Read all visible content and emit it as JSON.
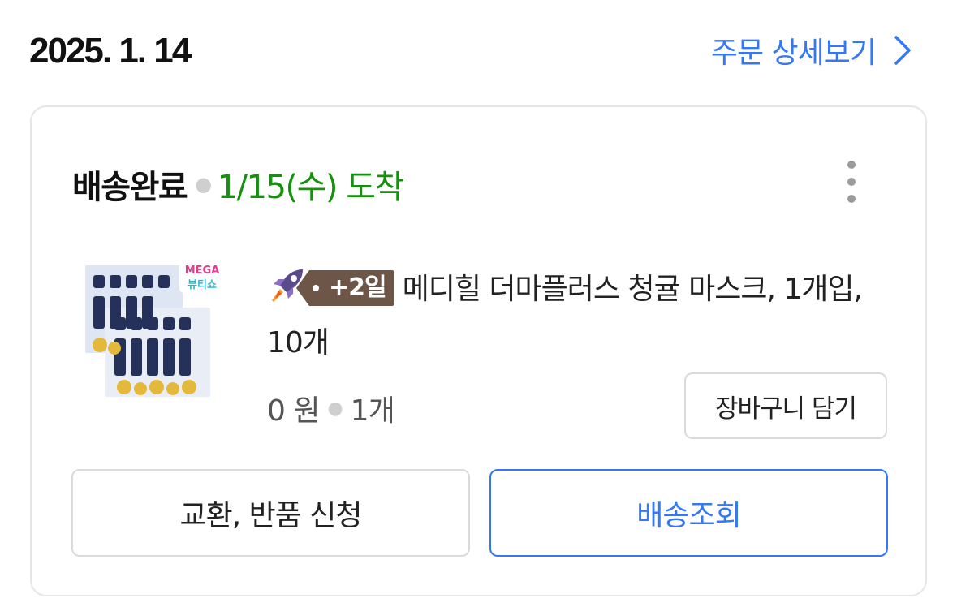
{
  "order": {
    "date": "2025. 1. 14",
    "detail_link": "주문 상세보기"
  },
  "card": {
    "status": "배송완료",
    "arrival": "1/15(수) 도착",
    "product": {
      "badge": "+2일",
      "name": "메디힐 더마플러스 청귤 마스크, 1개입, 10개",
      "price": "0 원",
      "quantity": "1개",
      "thumbnail_badge_top": "MEGA",
      "thumbnail_badge_bottom": "뷰티쇼"
    },
    "cart_button": "장바구니 담기",
    "exchange_button": "교환, 반품 신청",
    "tracking_button": "배송조회"
  },
  "icons": [
    "chevron-right-icon",
    "more-vertical-icon",
    "rocket-icon"
  ],
  "colors": {
    "accent": "#3478f6",
    "arrival_green": "#16900f",
    "badge_brown": "#6d5648",
    "border": "#dadada"
  }
}
